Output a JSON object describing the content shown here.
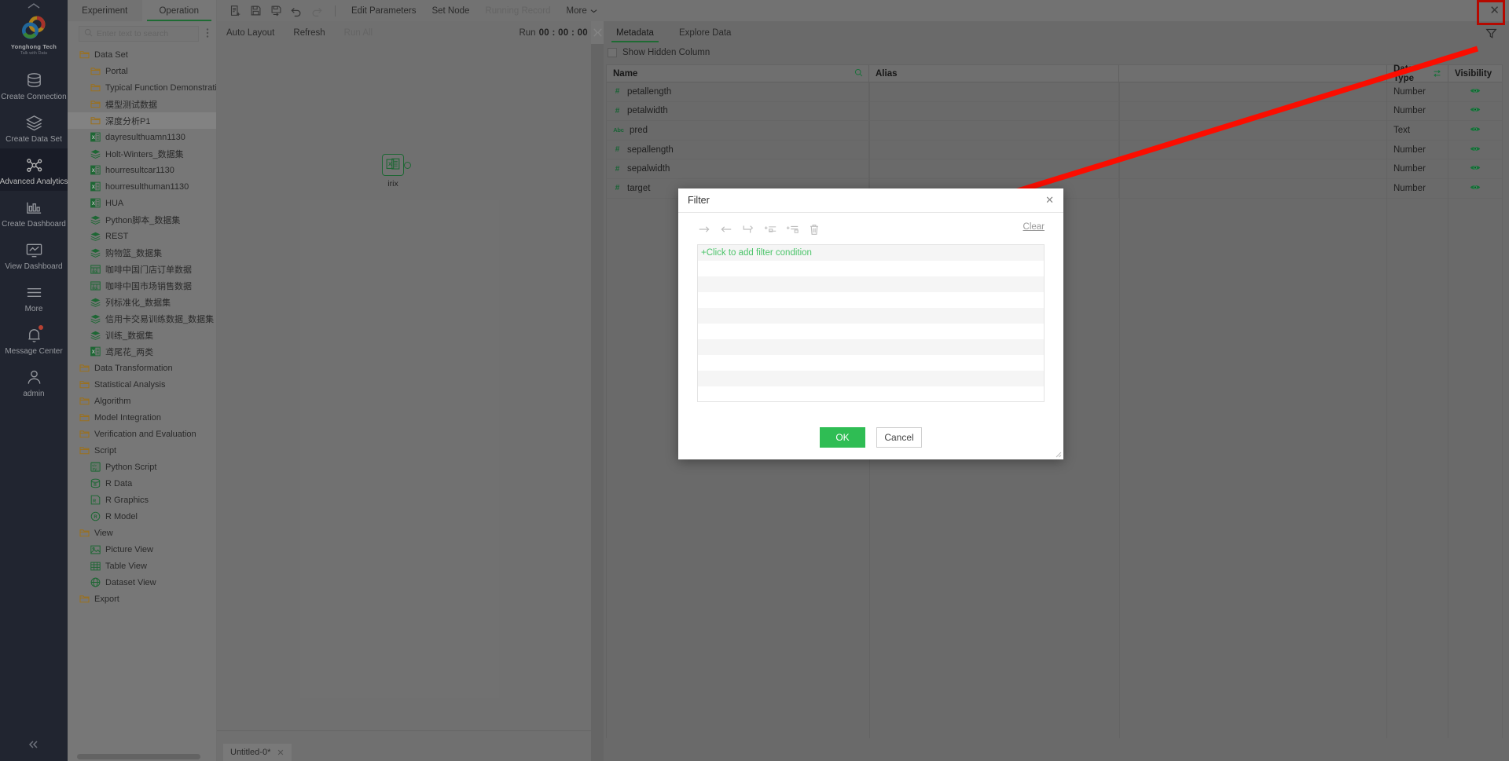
{
  "brand": {
    "name": "Yonghong Tech",
    "tagline": "Talk with Data"
  },
  "nav_rail": {
    "items": [
      {
        "label": "Create Connection",
        "icon": "database-icon",
        "active": false,
        "badge": false
      },
      {
        "label": "Create Data Set",
        "icon": "layers-icon",
        "active": false,
        "badge": false
      },
      {
        "label": "Advanced Analytics",
        "icon": "nodes-icon",
        "active": true,
        "badge": false
      },
      {
        "label": "Create Dashboard",
        "icon": "bar-chart-icon",
        "active": false,
        "badge": false
      },
      {
        "label": "View Dashboard",
        "icon": "monitor-chart-icon",
        "active": false,
        "badge": false
      },
      {
        "label": "More",
        "icon": "hamburger-icon",
        "active": false,
        "badge": false
      },
      {
        "label": "Message Center",
        "icon": "bell-icon",
        "active": false,
        "badge": true
      },
      {
        "label": "admin",
        "icon": "user-icon",
        "active": false,
        "badge": false
      }
    ]
  },
  "left_panel": {
    "tabs": [
      {
        "label": "Experiment",
        "active": false
      },
      {
        "label": "Operation",
        "active": true
      }
    ],
    "search": {
      "placeholder": "Enter text to search",
      "value": ""
    },
    "more_icon": "kebab-menu-icon",
    "tree": [
      {
        "label": "Data Set",
        "depth": 0,
        "icon": "folder-icon",
        "selected": false
      },
      {
        "label": "Portal",
        "depth": 1,
        "icon": "folder-icon",
        "selected": false
      },
      {
        "label": "Typical Function Demonstration",
        "depth": 1,
        "icon": "folder-icon",
        "selected": false
      },
      {
        "label": "模型测试数据",
        "depth": 1,
        "icon": "folder-icon",
        "selected": false
      },
      {
        "label": "深度分析P1",
        "depth": 1,
        "icon": "folder-icon",
        "selected": true
      },
      {
        "label": "dayresulthuamn1130",
        "depth": 1,
        "icon": "excel-icon",
        "selected": false
      },
      {
        "label": "Holt-Winters_数据集",
        "depth": 1,
        "icon": "dataset-icon",
        "selected": false
      },
      {
        "label": "hourresultcar1130",
        "depth": 1,
        "icon": "excel-icon",
        "selected": false
      },
      {
        "label": "hourresulthuman1130",
        "depth": 1,
        "icon": "excel-icon",
        "selected": false
      },
      {
        "label": "HUA",
        "depth": 1,
        "icon": "excel-icon",
        "selected": false
      },
      {
        "label": "Python脚本_数据集",
        "depth": 1,
        "icon": "dataset-icon",
        "selected": false
      },
      {
        "label": "REST",
        "depth": 1,
        "icon": "dataset-icon",
        "selected": false
      },
      {
        "label": "购物篮_数据集",
        "depth": 1,
        "icon": "dataset-icon",
        "selected": false
      },
      {
        "label": "咖啡中国门店订单数据",
        "depth": 1,
        "icon": "sql-icon",
        "selected": false
      },
      {
        "label": "咖啡中国市场销售数据",
        "depth": 1,
        "icon": "sql-icon",
        "selected": false
      },
      {
        "label": "列标准化_数据集",
        "depth": 1,
        "icon": "dataset-icon",
        "selected": false
      },
      {
        "label": "信用卡交易训练数据_数据集",
        "depth": 1,
        "icon": "dataset-icon",
        "selected": false
      },
      {
        "label": "训练_数据集",
        "depth": 1,
        "icon": "dataset-icon",
        "selected": false
      },
      {
        "label": "鸢尾花_两类",
        "depth": 1,
        "icon": "excel-icon",
        "selected": false
      },
      {
        "label": "Data Transformation",
        "depth": 0,
        "icon": "folder-icon",
        "selected": false
      },
      {
        "label": "Statistical Analysis",
        "depth": 0,
        "icon": "folder-icon",
        "selected": false
      },
      {
        "label": "Algorithm",
        "depth": 0,
        "icon": "folder-icon",
        "selected": false
      },
      {
        "label": "Model Integration",
        "depth": 0,
        "icon": "folder-icon",
        "selected": false
      },
      {
        "label": "Verification and Evaluation",
        "depth": 0,
        "icon": "folder-icon",
        "selected": false
      },
      {
        "label": "Script",
        "depth": 0,
        "icon": "folder-icon",
        "selected": false
      },
      {
        "label": "Python Script",
        "depth": 1,
        "icon": "python-icon",
        "selected": false
      },
      {
        "label": "R Data",
        "depth": 1,
        "icon": "r-data-icon",
        "selected": false
      },
      {
        "label": "R Graphics",
        "depth": 1,
        "icon": "r-graphics-icon",
        "selected": false
      },
      {
        "label": "R Model",
        "depth": 1,
        "icon": "r-model-icon",
        "selected": false
      },
      {
        "label": "View",
        "depth": 0,
        "icon": "folder-icon",
        "selected": false
      },
      {
        "label": "Picture View",
        "depth": 1,
        "icon": "picture-view-icon",
        "selected": false
      },
      {
        "label": "Table View",
        "depth": 1,
        "icon": "table-view-icon",
        "selected": false
      },
      {
        "label": "Dataset View",
        "depth": 1,
        "icon": "dataset-view-icon",
        "selected": false
      },
      {
        "label": "Export",
        "depth": 0,
        "icon": "folder-icon",
        "selected": false
      }
    ]
  },
  "toolbar": {
    "icon_buttons": [
      {
        "name": "new-node-icon",
        "disabled": false
      },
      {
        "name": "save-icon",
        "disabled": false
      },
      {
        "name": "save-as-icon",
        "disabled": false
      },
      {
        "name": "undo-icon",
        "disabled": false
      },
      {
        "name": "redo-icon",
        "disabled": true
      }
    ],
    "text_buttons": [
      {
        "label": "Edit Parameters",
        "disabled": false,
        "caret": false
      },
      {
        "label": "Set Node",
        "disabled": false,
        "caret": false
      },
      {
        "label": "Running Record",
        "disabled": true,
        "caret": false
      },
      {
        "label": "More",
        "disabled": false,
        "caret": true
      }
    ],
    "close_label": "✕"
  },
  "toolbar2": {
    "buttons": [
      {
        "label": "Auto Layout",
        "disabled": false
      },
      {
        "label": "Refresh",
        "disabled": false
      },
      {
        "label": "Run All",
        "disabled": true
      }
    ]
  },
  "run_timer": {
    "label": "Run",
    "value": "00 : 00 : 00"
  },
  "canvas": {
    "node": {
      "label": "irix",
      "icon": "excel-node-icon"
    }
  },
  "bottom_bar": {
    "tab": {
      "label": "Untitled-0*",
      "close": "✕"
    }
  },
  "right_panel": {
    "tabs": [
      {
        "label": "Metadata",
        "active": true
      },
      {
        "label": "Explore Data",
        "active": false
      }
    ],
    "filter_icon": "filter-funnel-icon",
    "show_hidden_column": {
      "label": "Show Hidden Column",
      "checked": false
    },
    "table": {
      "columns": [
        "Name",
        "Alias",
        "Data Type",
        "Visibility"
      ],
      "name_search_icon": "search-icon",
      "data_type_icon": "swap-icon",
      "rows": [
        {
          "name": "petallength",
          "badge": "#",
          "badge_kind": "number",
          "alias": "",
          "data_type": "Number",
          "visibility_icon": "eye-icon"
        },
        {
          "name": "petalwidth",
          "badge": "#",
          "badge_kind": "number",
          "alias": "",
          "data_type": "Number",
          "visibility_icon": "eye-icon"
        },
        {
          "name": "pred",
          "badge": "Abc",
          "badge_kind": "text",
          "alias": "",
          "data_type": "Text",
          "visibility_icon": "eye-icon"
        },
        {
          "name": "sepallength",
          "badge": "#",
          "badge_kind": "number",
          "alias": "",
          "data_type": "Number",
          "visibility_icon": "eye-icon"
        },
        {
          "name": "sepalwidth",
          "badge": "#",
          "badge_kind": "number",
          "alias": "",
          "data_type": "Number",
          "visibility_icon": "eye-icon"
        },
        {
          "name": "target",
          "badge": "#",
          "badge_kind": "number",
          "alias": "",
          "data_type": "Number",
          "visibility_icon": "eye-icon"
        }
      ]
    }
  },
  "filter_dialog": {
    "title": "Filter",
    "close": "✕",
    "tools": [
      {
        "name": "indent-right-icon"
      },
      {
        "name": "indent-left-icon"
      },
      {
        "name": "move-down-icon"
      },
      {
        "name": "add-condition-icon"
      },
      {
        "name": "add-group-icon"
      },
      {
        "name": "delete-icon"
      }
    ],
    "clear_label": "Clear",
    "add_condition_label": "+Click to add filter condition",
    "ok_label": "OK",
    "cancel_label": "Cancel",
    "resize_icon": "resize-grip-icon"
  },
  "annotation": {
    "arrow": "red-arrow-pointing-to-filter-dialog",
    "highlight_box": "red-highlight-on-filter-button"
  },
  "colors": {
    "accent_green": "#2a9547",
    "button_green": "#2fbd54",
    "annotation_red": "#fb0d00",
    "nav_dark": "#2f3443",
    "folder_orange": "#d79b28"
  }
}
